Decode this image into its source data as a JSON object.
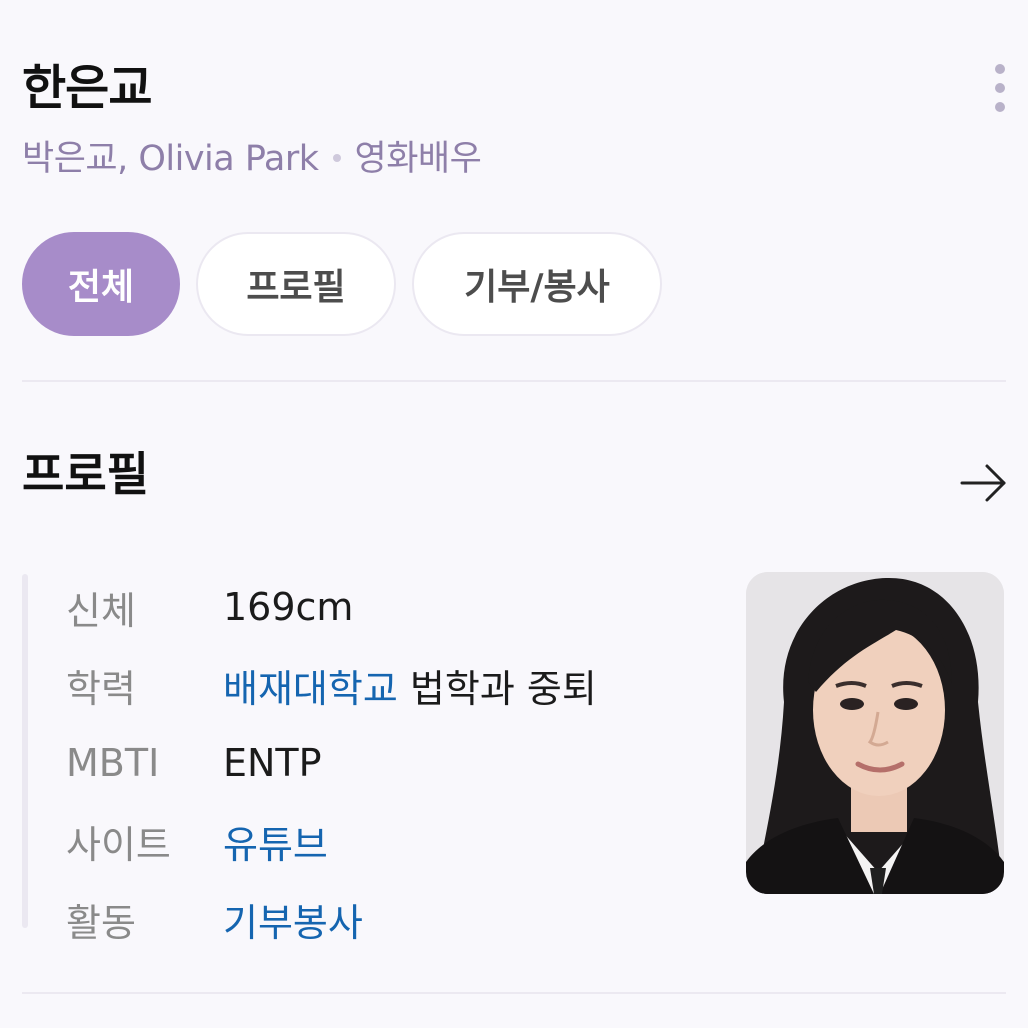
{
  "header": {
    "name": "한은교",
    "aliases": "박은교, Olivia Park",
    "occupation": "영화배우"
  },
  "tabs": [
    {
      "label": "전체",
      "active": true
    },
    {
      "label": "프로필",
      "active": false
    },
    {
      "label": "기부/봉사",
      "active": false
    }
  ],
  "profile": {
    "title": "프로필",
    "rows": [
      {
        "label": "신체",
        "value": "169cm"
      },
      {
        "label": "학력",
        "link": "배재대학교",
        "value": "법학과 중퇴"
      },
      {
        "label": "MBTI",
        "value": "ENTP"
      },
      {
        "label": "사이트",
        "link": "유튜브"
      },
      {
        "label": "활동",
        "link": "기부봉사"
      }
    ]
  },
  "icons": {
    "more": "more-vertical-icon",
    "arrow": "arrow-right-icon"
  },
  "colors": {
    "accent": "#a78cc9",
    "subtitle": "#8e7fa9",
    "link": "#1565b0"
  }
}
